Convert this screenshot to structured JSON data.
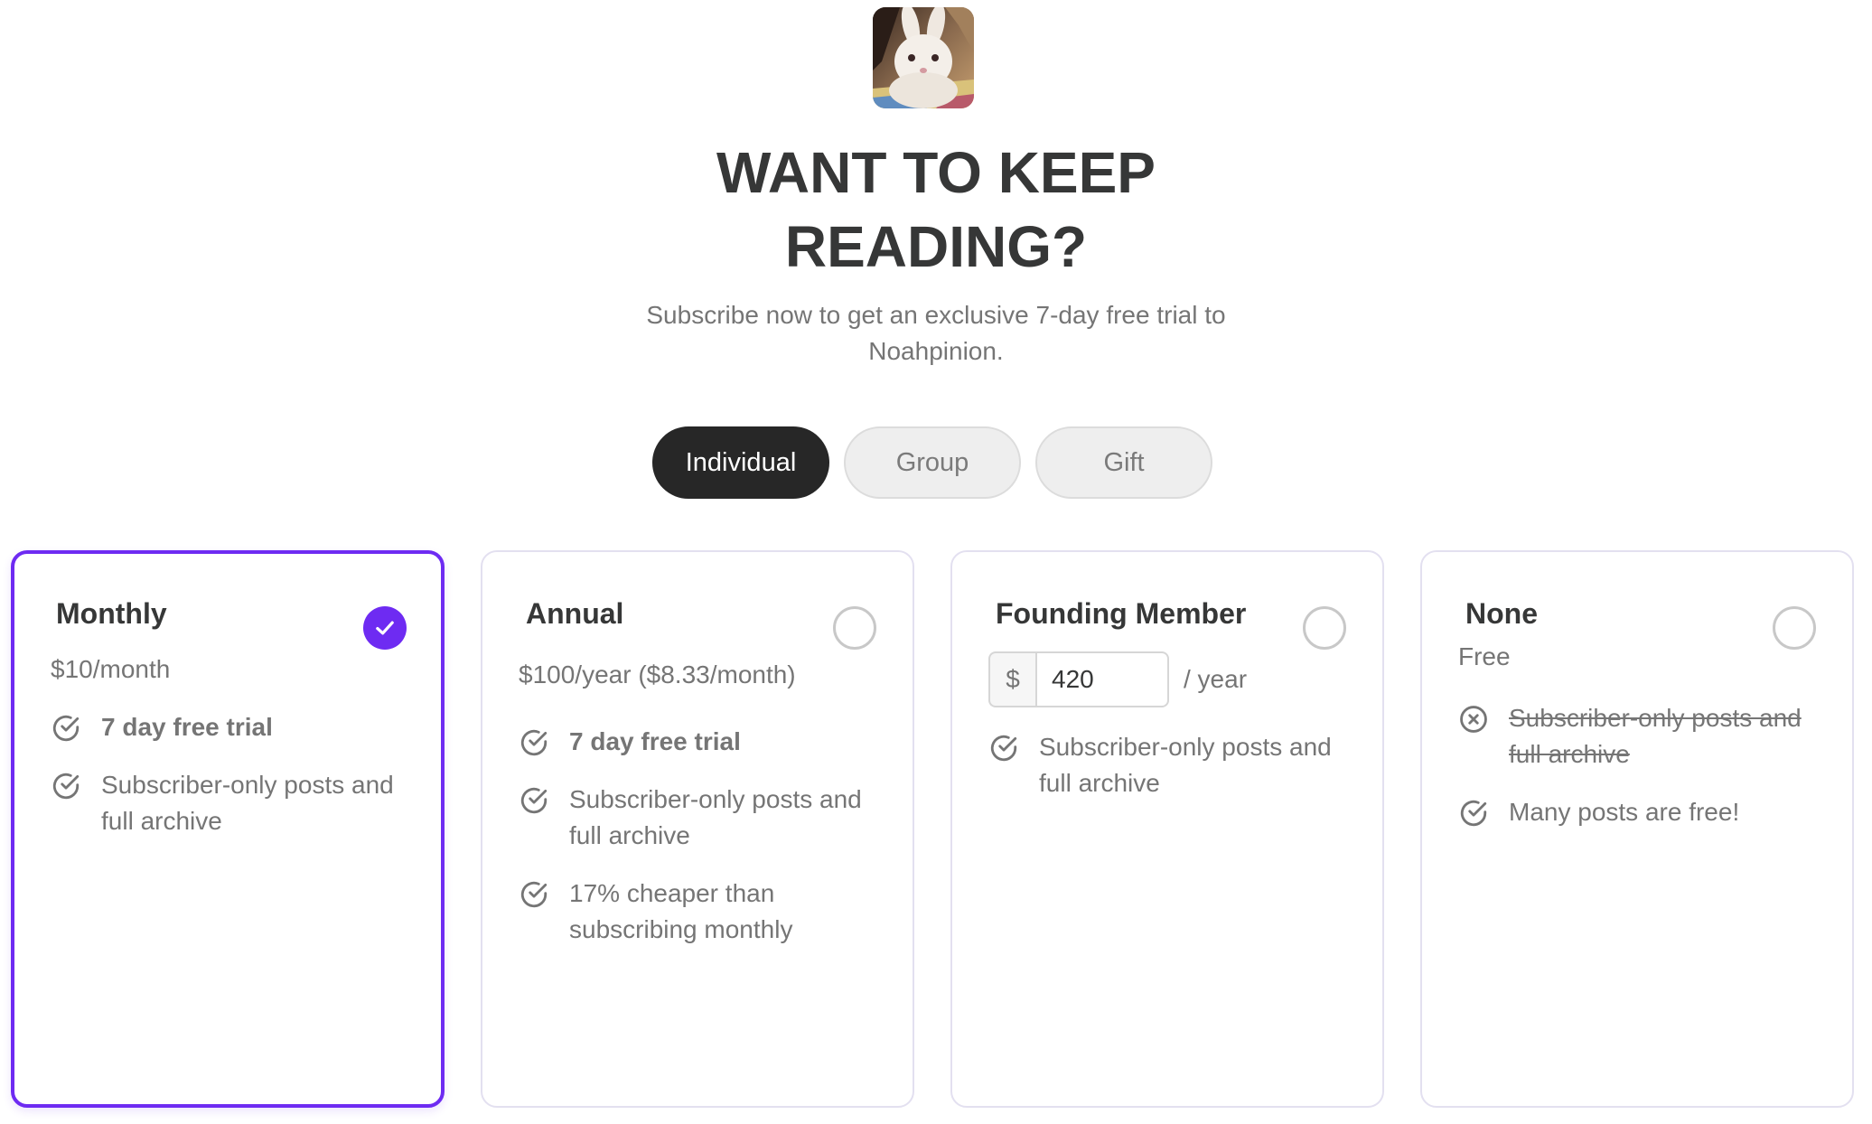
{
  "header": {
    "avatar_alt": "Noahpinion publication logo",
    "title_line1": "WANT TO KEEP",
    "title_line2": "READING?",
    "subtitle_line1": "Subscribe now to get an exclusive 7-day free trial to",
    "subtitle_line2": "Noahpinion."
  },
  "tabs": [
    {
      "label": "Individual",
      "active": true
    },
    {
      "label": "Group",
      "active": false
    },
    {
      "label": "Gift",
      "active": false
    }
  ],
  "accent_color": "#6e2bf2",
  "plans": [
    {
      "name": "Monthly",
      "price": "$10/month",
      "selected": true,
      "features": [
        {
          "text": "7 day free trial",
          "icon": "check-circle-icon"
        },
        {
          "text": "Subscriber-only posts and full archive",
          "icon": "check-circle-icon"
        }
      ]
    },
    {
      "name": "Annual",
      "price": "$100/year ($8.33/month)",
      "selected": false,
      "features": [
        {
          "text": "7 day free trial",
          "icon": "check-circle-icon"
        },
        {
          "text": "Subscriber-only posts and full archive",
          "icon": "check-circle-icon"
        },
        {
          "text": "17% cheaper than subscribing monthly",
          "icon": "check-circle-icon"
        }
      ]
    },
    {
      "name": "Founding Member",
      "currency_symbol": "$",
      "amount": "420",
      "period": "/ year",
      "selected": false,
      "features": [
        {
          "text": "Subscriber-only posts and full archive",
          "icon": "check-circle-icon"
        }
      ]
    },
    {
      "name": "None",
      "price": "Free",
      "selected": false,
      "features": [
        {
          "text": "Subscriber-only posts and full archive",
          "icon": "x-circle-icon"
        },
        {
          "text": "Many posts are free!",
          "icon": "check-circle-icon"
        }
      ]
    }
  ]
}
